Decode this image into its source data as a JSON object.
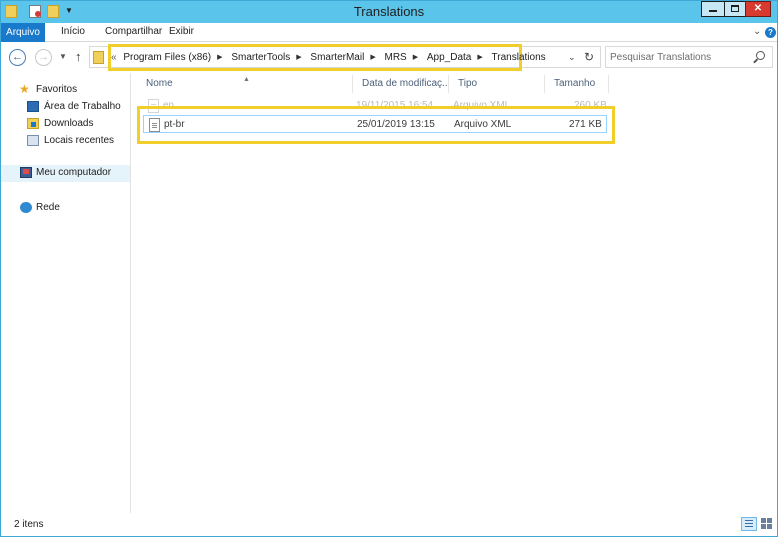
{
  "window": {
    "title": "Translations"
  },
  "ribbon": {
    "tabs": [
      {
        "label": "Arquivo"
      },
      {
        "label": "Início"
      },
      {
        "label": "Compartilhar"
      },
      {
        "label": "Exibir"
      }
    ]
  },
  "address": {
    "overflow": "«",
    "crumbs": [
      "Program Files (x86)",
      "SmarterTools",
      "SmarterMail",
      "MRS",
      "App_Data",
      "Translations"
    ]
  },
  "search": {
    "placeholder": "Pesquisar Translations"
  },
  "navpane": {
    "favorites": {
      "label": "Favoritos",
      "icon": "star-icon"
    },
    "favorite_items": [
      {
        "label": "Área de Trabalho",
        "icon": "desktop-icon"
      },
      {
        "label": "Downloads",
        "icon": "downloads-icon"
      },
      {
        "label": "Locais recentes",
        "icon": "recent-places-icon"
      }
    ],
    "computer": {
      "label": "Meu computador",
      "icon": "computer-icon"
    },
    "network": {
      "label": "Rede",
      "icon": "network-icon"
    }
  },
  "filelist": {
    "columns": [
      "Nome",
      "Data de modificaç...",
      "Tipo",
      "Tamanho"
    ],
    "rows": [
      {
        "name": "en",
        "modified": "19/11/2015 16:54",
        "type": "Arquivo XML",
        "size": "260 KB"
      },
      {
        "name": "pt-br",
        "modified": "25/01/2019 13:15",
        "type": "Arquivo XML",
        "size": "271 KB"
      }
    ]
  },
  "status": {
    "item_count": "2 itens"
  },
  "colors": {
    "titlebar": "#5bc4ea",
    "accent": "#1979ca",
    "highlight": "#f0cf2a"
  }
}
